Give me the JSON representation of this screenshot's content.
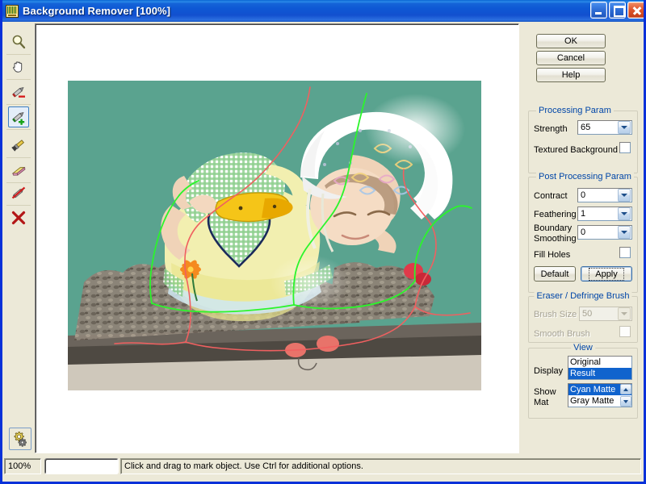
{
  "window": {
    "title": "Background Remover [100%]",
    "icon": "app-icon",
    "buttons": {
      "minimize": "minimize",
      "maximize": "maximize",
      "close": "close"
    }
  },
  "toolbar": {
    "tools": [
      {
        "name": "zoom-tool",
        "icon": "magnifier-icon",
        "selected": false
      },
      {
        "name": "pan-tool",
        "icon": "hand-icon",
        "selected": false
      },
      {
        "name": "mark-background-tool",
        "icon": "pencil-minus-icon",
        "selected": false
      },
      {
        "name": "mark-object-tool",
        "icon": "pencil-plus-icon",
        "selected": true
      },
      {
        "name": "defringe-brush-tool",
        "icon": "brush-icon",
        "selected": false
      },
      {
        "name": "eraser-tool",
        "icon": "eraser-icon",
        "selected": false
      },
      {
        "name": "remove-marks-tool",
        "icon": "pencil-strike-icon",
        "selected": false
      },
      {
        "name": "clear-all-tool",
        "icon": "red-x-icon",
        "selected": false
      }
    ],
    "settings": {
      "label": "Settings",
      "icon": "gears-icon"
    }
  },
  "actions": {
    "ok": "OK",
    "cancel": "Cancel",
    "help": "Help"
  },
  "processing_param": {
    "title": "Processing Param",
    "strength": {
      "label": "Strength",
      "value": "65"
    },
    "textured_background": {
      "label": "Textured Background",
      "checked": false
    }
  },
  "post_processing_param": {
    "title": "Post Processing Param",
    "contract": {
      "label": "Contract",
      "value": "0"
    },
    "feathering": {
      "label": "Feathering",
      "value": "1"
    },
    "boundary_smoothing": {
      "label_line1": "Boundary",
      "label_line2": "Smoothing",
      "value": "0"
    },
    "fill_holes": {
      "label": "Fill Holes",
      "checked": false
    },
    "default_button": "Default",
    "apply_button": "Apply"
  },
  "eraser_defringe_brush": {
    "title": "Eraser / Defringe  Brush",
    "enabled": false,
    "brush_size": {
      "label": "Brush Size",
      "value": "50"
    },
    "smooth_brush": {
      "label": "Smooth Brush",
      "checked": false
    }
  },
  "view": {
    "title": "View",
    "display": {
      "label": "Display",
      "options": [
        "Original",
        "Result"
      ],
      "selected": "Result"
    },
    "show_mat": {
      "label_line1": "Show",
      "label_line2": "Mat",
      "options": [
        "Cyan Matte",
        "Gray Matte"
      ],
      "selected": "Cyan Matte"
    }
  },
  "statusbar": {
    "zoom": "100%",
    "progress": "",
    "hint": "Click and drag to mark object. Use Ctrl for additional options."
  },
  "canvas": {
    "matte_color": "#5aa38f",
    "object_stroke_color": "#2bf52b",
    "background_stroke_color": "#f06060",
    "description": "Photo of a baby in a white lace bonnet and green gingham dress with a yellow apron, crawling on muddy ground, shown over a cyan matte with red background marks and green object marks."
  }
}
